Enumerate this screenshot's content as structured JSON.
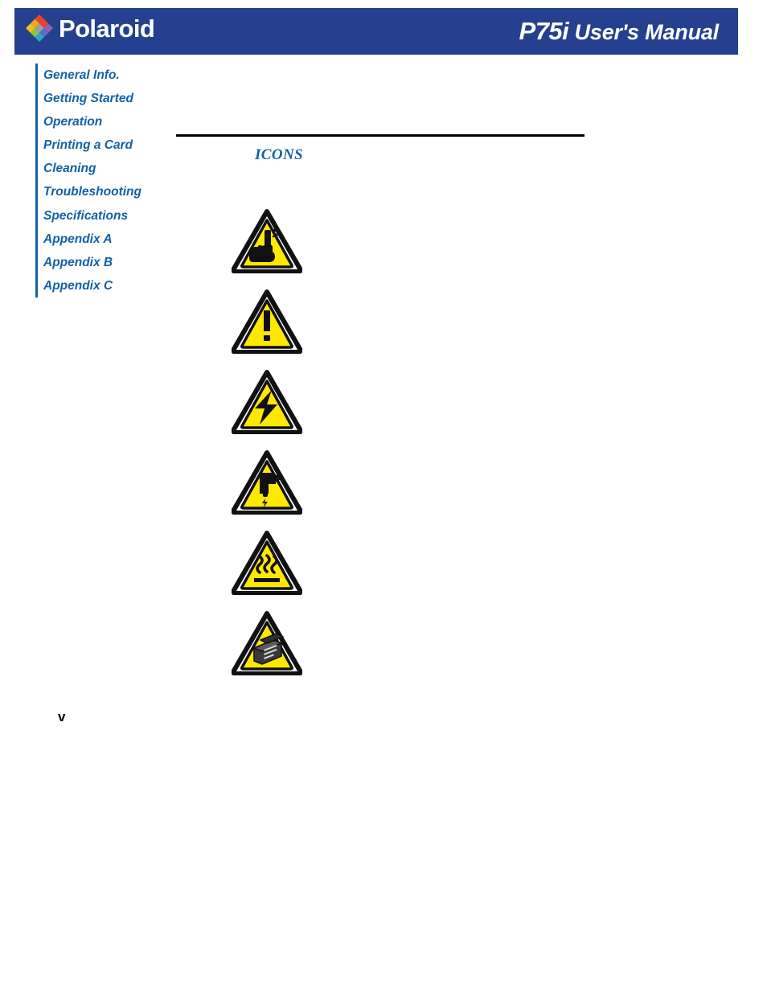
{
  "header": {
    "brand": "Polaroid",
    "logo_icon": "polaroid-diamond-icon",
    "logo_colors": [
      "#e8452c",
      "#e8452c",
      "#8a62b0",
      "#f2a61b",
      "#9aa0a6",
      "#5b6fc0",
      "#f2c41b",
      "#8cc63f",
      "#2aa8c4"
    ],
    "band_color": "#24408e",
    "title_model": "P75i",
    "title_subtitle": " User's Manual"
  },
  "sidebar": {
    "accent_color": "#1460a8",
    "items": [
      {
        "label": "General Info."
      },
      {
        "label": "Getting Started"
      },
      {
        "label": "Operation"
      },
      {
        "label": "Printing a Card"
      },
      {
        "label": "Cleaning"
      },
      {
        "label": "Troubleshooting"
      },
      {
        "label": "Specifications"
      },
      {
        "label": "Appendix A"
      },
      {
        "label": "Appendix B"
      },
      {
        "label": "Appendix C"
      }
    ]
  },
  "content": {
    "section_title": "ICONS",
    "rule_color": "#000000",
    "icons": [
      {
        "name": "pointing-hand-note-icon",
        "alt": "Important general information",
        "triangle_fill": "#ffe800"
      },
      {
        "name": "exclamation-warning-icon",
        "alt": "Caution / general warning",
        "triangle_fill": "#ffe800"
      },
      {
        "name": "electric-shock-hazard-icon",
        "alt": "Electrical shock hazard",
        "triangle_fill": "#ffe800"
      },
      {
        "name": "electrostatic-discharge-icon",
        "alt": "Electrostatic discharge hazard",
        "triangle_fill": "#ffe800"
      },
      {
        "name": "hot-surface-icon",
        "alt": "Hot surface",
        "triangle_fill": "#ffe800"
      },
      {
        "name": "printhead-caution-icon",
        "alt": "Print head caution",
        "triangle_fill": "#ffe800"
      }
    ]
  },
  "footer": {
    "page_number": "v"
  }
}
